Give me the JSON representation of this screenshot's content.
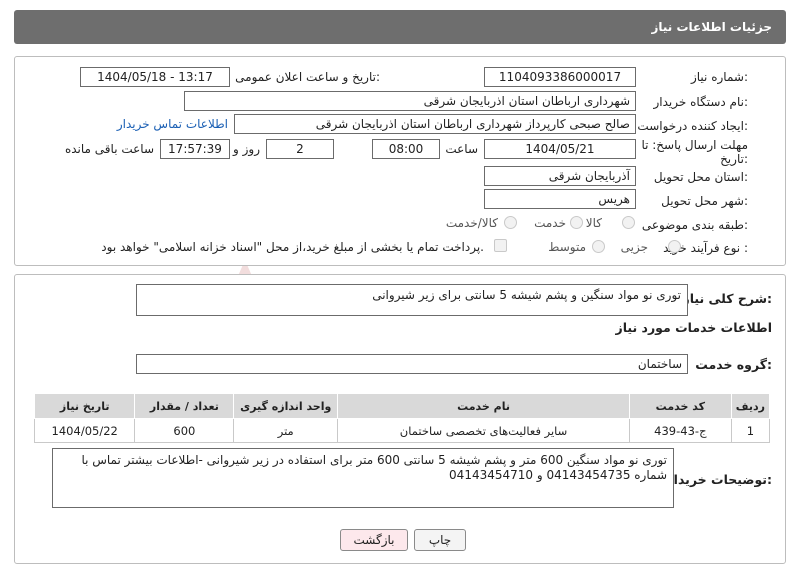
{
  "page": {
    "title": "جزئیات اطلاعات نیاز"
  },
  "form": {
    "need_number_label": "شماره نیاز:",
    "need_number": "1104093386000017",
    "announce_label": "تاریخ و ساعت اعلان عمومی:",
    "announce_value": "1404/05/18 - 13:17",
    "buyer_org_label": "نام دستگاه خریدار:",
    "buyer_org": "شهرداری ارباطان استان اذربایجان شرقی",
    "requester_label": "ایجاد کننده درخواست:",
    "requester": "صالح صبحی کارپرداز شهرداری ارباطان استان اذربایجان شرقی",
    "buyer_contact_link": "اطلاعات تماس خریدار",
    "deadline_label": "مهلت ارسال پاسخ: تا تاریخ:",
    "deadline_date": "1404/05/21",
    "time_label": "ساعت",
    "deadline_time": "08:00",
    "days_value": "2",
    "days_label": "روز و",
    "remaining_time": "17:57:39",
    "remaining_label": "ساعت باقی مانده",
    "province_label": "استان محل تحویل:",
    "province": "آذربایجان شرقی",
    "city_label": "شهر محل تحویل:",
    "city": "هریس",
    "category_label": "طبقه بندی موضوعی:",
    "category_options": [
      "کالا",
      "خدمت",
      "کالا/خدمت"
    ],
    "process_label": "نوع فرآیند خرید :",
    "process_options": [
      "جزیی",
      "متوسط"
    ],
    "payment_note": "پرداخت تمام یا بخشی از مبلغ خرید،از محل \"اسناد خزانه اسلامی\" خواهد بود."
  },
  "summary": {
    "label": "شرح کلی نیاز:",
    "text": "توری نو مواد سنگین و پشم شیشه 5 سانتی برای زیر شیروانی"
  },
  "services": {
    "section_title": "اطلاعات خدمات مورد نیاز",
    "group_label": "گروه خدمت:",
    "group_value": "ساختمان",
    "headers": [
      "ردیف",
      "کد خدمت",
      "نام خدمت",
      "واحد اندازه گیری",
      "تعداد / مقدار",
      "تاریخ نیاز"
    ],
    "rows": [
      {
        "index": "1",
        "code": "ج-43-439",
        "name": "سایر فعالیت‌های تخصصی ساختمان",
        "unit": "متر",
        "qty": "600",
        "date": "1404/05/22"
      }
    ]
  },
  "buyer_notes": {
    "label": "توضیحات خریدار:",
    "text": "توری نو مواد سنگین 600 متر و پشم شیشه 5 سانتی 600 متر برای استفاده در زیر شیروانی -اطلاعات بیشتر تماس با شماره 04143454735 و 04143454710"
  },
  "buttons": {
    "print": "چاپ",
    "back": "بازگشت"
  },
  "watermark": {
    "text": "AriaTender.neT"
  },
  "colors": {
    "title_bg": "#6e6e6e",
    "link": "#1a5fb4",
    "back_btn_bg": "#fde8ec",
    "header_bg": "#d9d9d9"
  }
}
